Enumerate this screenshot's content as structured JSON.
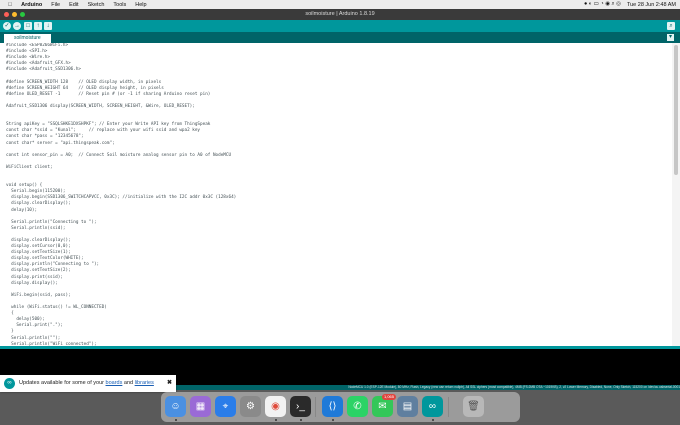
{
  "menubar": {
    "apple": "",
    "app_name": "Arduino",
    "items": [
      "File",
      "Edit",
      "Sketch",
      "Tools",
      "Help"
    ],
    "clock": "Tue 28 Jun  2:48 AM"
  },
  "window": {
    "title": "soilmoisture | Arduino 1.8.19"
  },
  "toolbar": {
    "verify": "✓",
    "upload": "→",
    "new": "□",
    "open": "↑",
    "save": "↓",
    "serial_monitor": "⌕"
  },
  "tab": {
    "name": "soilmoisture",
    "menu": "▾"
  },
  "code": "#include <ESP8266WiFi.h>\n#include <SPI.h>\n#include <Wire.h>\n#include <Adafruit_GFX.h>\n#include <Adafruit_SSD1306.h>\n\n#define SCREEN_WIDTH 128    // OLED display width, in pixels\n#define SCREEN_HEIGHT 64    // OLED display height, in pixels\n#define OLED_RESET -1       // Reset pin # (or -1 if sharing Arduino reset pin)\n\nAdafruit_SSD1306 display(SCREEN_WIDTH, SCREEN_HEIGHT, &Wire, OLED_RESET);\n\n\nString apiKey = \"SSQLSHKE1DXSHPKF\"; // Enter your Write API key from ThingSpeak\nconst char *ssid = \"Kunal\";     // replace with your wifi ssid and wpa2 key\nconst char *pass = \"12345678\";\nconst char* server = \"api.thingspeak.com\";\n\nconst int sensor_pin = A0;  // Connect Soil moisture analog sensor pin to A0 of NodeMCU\n\nWiFiClient client;\n\n\nvoid setup() {\n  Serial.begin(115200);\n  display.begin(SSD1306_SWITCHCAPVCC, 0x3C); //initialize with the I2C addr 0x3C (128x64)\n  display.clearDisplay();\n  delay(10);\n\n  Serial.println(\"Connecting to \");\n  Serial.println(ssid);\n\n  display.clearDisplay();\n  display.setCursor(0,0);\n  display.setTextSize(1);\n  display.setTextColor(WHITE);\n  display.println(\"Connecting to \");\n  display.setTextSize(2);\n  display.print(ssid);\n  display.display();\n\n  WiFi.begin(ssid, pass);\n\n  while (WiFi.status() != WL_CONNECTED)\n  {\n    delay(500);\n    Serial.print(\".\");\n  }\n  Serial.println(\"\");\n  Serial.println(\"WiFi connected\");",
  "status_line": "NodeMCU 1.0 (ESP-12E Module), 80 MHz, Flash, Legacy (new can return nullptr), All SSL ciphers (most compatible), 4MB (FS:2MB OTA:~1019KB), 2, v2 Lower Memory, Disabled, None, Only Sketch, 115200 on /dev/cu.usbserial-0001",
  "notification": {
    "text": "Updates available for some of your",
    "link1": "boards",
    "and": "and",
    "link2": "libraries",
    "close": "✖"
  },
  "dock": {
    "messages_badge": "1,065"
  }
}
